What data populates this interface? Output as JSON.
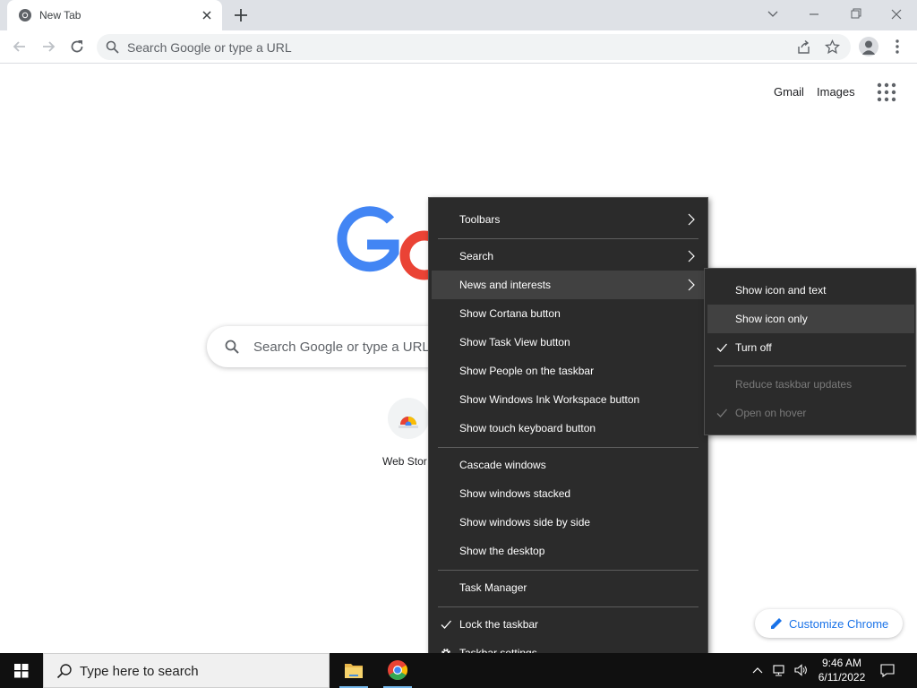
{
  "browser": {
    "tab": {
      "title": "New Tab"
    },
    "omnibox": {
      "placeholder": "Search Google or type a URL"
    }
  },
  "ntp": {
    "header_links": [
      "Gmail",
      "Images"
    ],
    "search_placeholder": "Search Google or type a URL",
    "shortcut_label": "Web Stor",
    "customize_label": "Customize Chrome",
    "logo_colors": {
      "blue": "#4285f4",
      "red": "#ea4335"
    }
  },
  "context_menu": {
    "items": [
      {
        "label": "Toolbars",
        "submenu": true
      },
      {
        "label": "Search",
        "submenu": true
      },
      {
        "label": "News and interests",
        "submenu": true,
        "highlighted": true
      },
      {
        "label": "Show Cortana button"
      },
      {
        "label": "Show Task View button"
      },
      {
        "label": "Show People on the taskbar"
      },
      {
        "label": "Show Windows Ink Workspace button"
      },
      {
        "label": "Show touch keyboard button"
      },
      {
        "label": "Cascade windows"
      },
      {
        "label": "Show windows stacked"
      },
      {
        "label": "Show windows side by side"
      },
      {
        "label": "Show the desktop"
      },
      {
        "label": "Task Manager"
      },
      {
        "label": "Lock the taskbar",
        "checked": true
      },
      {
        "label": "Taskbar settings",
        "icon": "gear-icon"
      }
    ]
  },
  "submenu": {
    "items": [
      {
        "label": "Show icon and text"
      },
      {
        "label": "Show icon only",
        "highlighted": true
      },
      {
        "label": "Turn off",
        "checked": true
      },
      {
        "label": "Reduce taskbar updates",
        "disabled": true
      },
      {
        "label": "Open on hover",
        "disabled": true,
        "checked": true
      }
    ]
  },
  "taskbar": {
    "search_placeholder": "Type here to search",
    "apps": [
      "file-explorer-icon",
      "chrome-icon"
    ],
    "tray_icons": [
      "chevron-up-icon",
      "network-icon",
      "volume-icon"
    ],
    "clock": {
      "time": "9:46 AM",
      "date": "6/11/2022"
    }
  },
  "colors": {
    "menu_bg": "#2b2b2b",
    "menu_highlight": "#414141",
    "taskbar_bg": "#101010",
    "tabstrip_bg": "#dee1e6",
    "accent_blue": "#1a73e8"
  }
}
